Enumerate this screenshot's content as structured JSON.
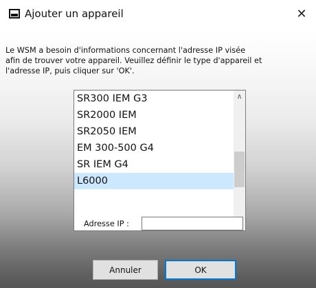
{
  "window": {
    "title": "Ajouter un appareil",
    "close_glyph": "✕",
    "icon": "sennheiser-logo-icon"
  },
  "message": {
    "line1": "Le WSM a besoin d'informations concernant l'adresse IP visée",
    "line2": "afin de trouver votre appareil. Veuillez définir le type d'appareil et",
    "line3": "l'adresse IP, puis cliquer sur 'OK'."
  },
  "device_list": {
    "items": [
      "SR300 IEM G3",
      "SR2000 IEM",
      "SR2050 IEM",
      "EM 300-500 G4",
      "SR IEM G4",
      "L6000"
    ],
    "selected": "L6000",
    "scroll_up_glyph": "∧",
    "scroll_down_glyph": "∨"
  },
  "ip": {
    "label": "Adresse IP :",
    "value": ""
  },
  "buttons": {
    "cancel": "Annuler",
    "ok": "OK"
  },
  "colors": {
    "selection": "#cce8ff",
    "ok_border": "#0078d7"
  }
}
